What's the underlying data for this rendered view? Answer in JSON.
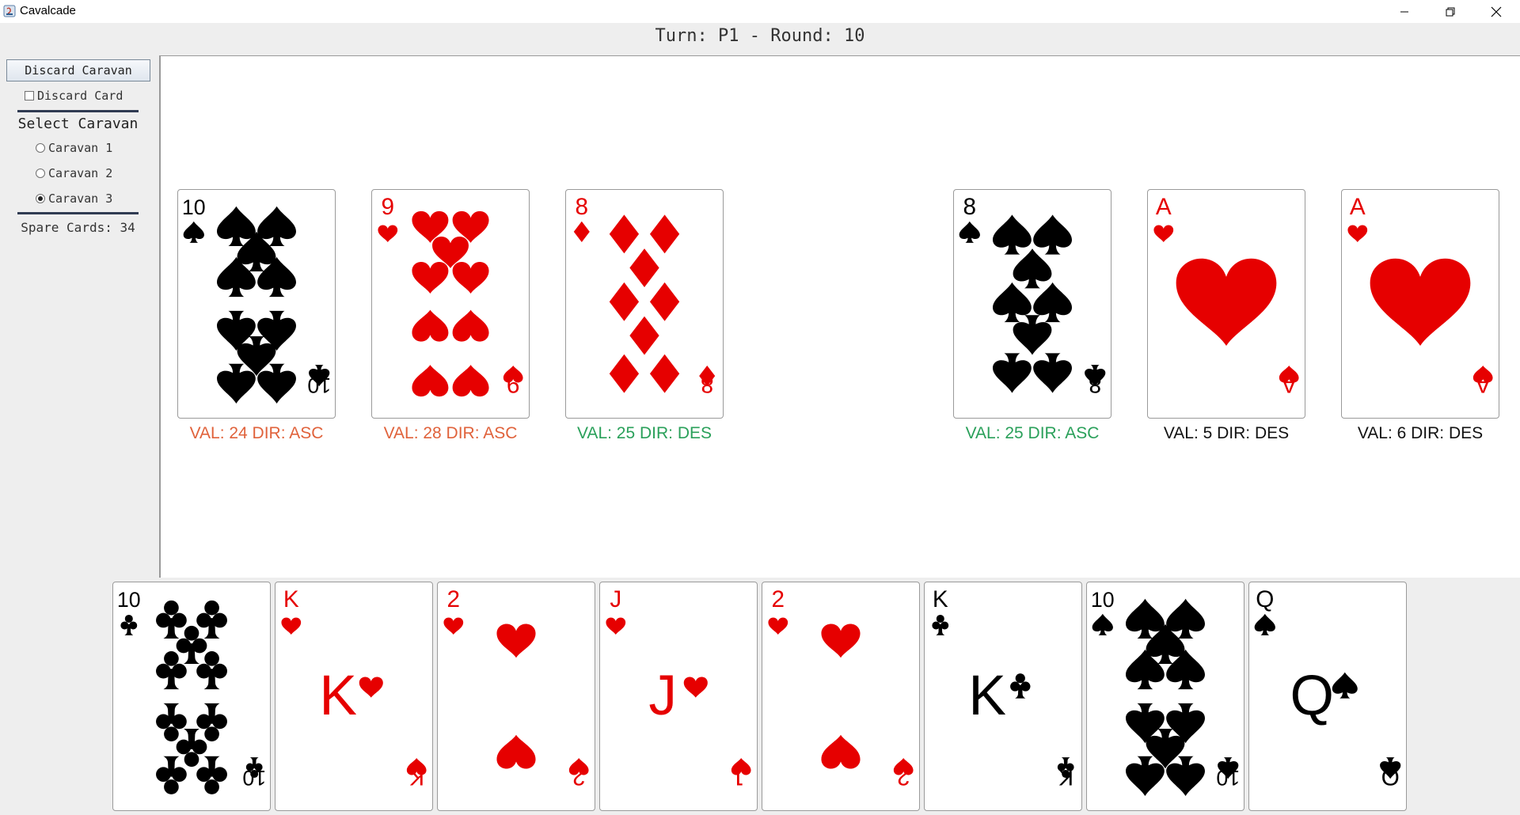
{
  "window": {
    "title": "Cavalcade",
    "controls": [
      "minimize-icon",
      "maximize-icon",
      "close-icon"
    ]
  },
  "header": {
    "turn_text": "Turn: P1 - Round: 10"
  },
  "controls": {
    "discard_caravan": "Discard Caravan",
    "discard_card": "Discard Card",
    "select_caravan": "Select Caravan",
    "caravans": [
      {
        "label": "Caravan 1",
        "selected": false
      },
      {
        "label": "Caravan 2",
        "selected": false
      },
      {
        "label": "Caravan 3",
        "selected": true
      }
    ],
    "spare_cards": "Spare Cards: 34"
  },
  "caravans": [
    {
      "rank": "10",
      "suit": "spades",
      "label": "VAL: 24 DIR: ASC",
      "label_color": "#e0623b"
    },
    {
      "rank": "9",
      "suit": "hearts",
      "label": "VAL: 28 DIR: ASC",
      "label_color": "#e0623b"
    },
    {
      "rank": "8",
      "suit": "diamonds",
      "label": "VAL: 25 DIR: DES",
      "label_color": "#2aa05a"
    },
    {
      "rank": "8",
      "suit": "spades",
      "label": "VAL: 25 DIR: ASC",
      "label_color": "#2aa05a"
    },
    {
      "rank": "A",
      "suit": "hearts",
      "label": "VAL: 5 DIR: DES",
      "label_color": "#111111"
    },
    {
      "rank": "A",
      "suit": "hearts",
      "label": "VAL: 6 DIR: DES",
      "label_color": "#111111"
    }
  ],
  "hand": [
    {
      "rank": "10",
      "suit": "clubs"
    },
    {
      "rank": "K",
      "suit": "hearts"
    },
    {
      "rank": "2",
      "suit": "hearts"
    },
    {
      "rank": "J",
      "suit": "hearts"
    },
    {
      "rank": "2",
      "suit": "hearts"
    },
    {
      "rank": "K",
      "suit": "clubs"
    },
    {
      "rank": "10",
      "suit": "spades"
    },
    {
      "rank": "Q",
      "suit": "spades"
    }
  ],
  "colors": {
    "red": "#e60000",
    "black": "#000000"
  }
}
